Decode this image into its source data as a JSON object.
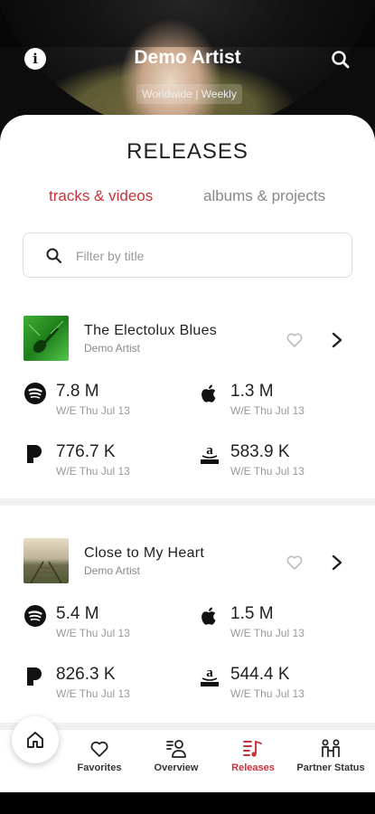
{
  "header": {
    "title": "Demo Artist",
    "subtitle": "Worldwide | Weekly",
    "info_icon": "info-icon",
    "search_icon": "search-icon"
  },
  "releases": {
    "title": "RELEASES",
    "tabs": [
      {
        "label": "tracks & videos",
        "active": true
      },
      {
        "label": "albums & projects",
        "active": false
      }
    ],
    "filter": {
      "placeholder": "Filter by title",
      "value": ""
    },
    "items": [
      {
        "title": "The Electolux Blues",
        "artist": "Demo Artist",
        "favorited": false,
        "metrics": {
          "spotify": {
            "value": "7.8 M",
            "date": "W/E Thu Jul 13"
          },
          "apple": {
            "value": "1.3 M",
            "date": "W/E Thu Jul 13"
          },
          "pandora": {
            "value": "776.7 K",
            "date": "W/E Thu Jul 13"
          },
          "amazon": {
            "value": "583.9 K",
            "date": "W/E Thu Jul 13"
          }
        }
      },
      {
        "title": "Close to My Heart",
        "artist": "Demo Artist",
        "favorited": false,
        "metrics": {
          "spotify": {
            "value": "5.4 M",
            "date": "W/E Thu Jul 13"
          },
          "apple": {
            "value": "1.5 M",
            "date": "W/E Thu Jul 13"
          },
          "pandora": {
            "value": "826.3 K",
            "date": "W/E Thu Jul 13"
          },
          "amazon": {
            "value": "544.4 K",
            "date": "W/E Thu Jul 13"
          }
        }
      }
    ]
  },
  "nav": {
    "items": [
      {
        "label": "Favorites",
        "icon": "heart-icon",
        "active": false
      },
      {
        "label": "Overview",
        "icon": "overview-icon",
        "active": false
      },
      {
        "label": "Releases",
        "icon": "releases-icon",
        "active": true
      },
      {
        "label": "Partner Status",
        "icon": "partner-status-icon",
        "active": false
      }
    ],
    "home_icon": "home-icon"
  },
  "colors": {
    "accent": "#c8323a",
    "text": "#222222",
    "muted": "#999999"
  }
}
